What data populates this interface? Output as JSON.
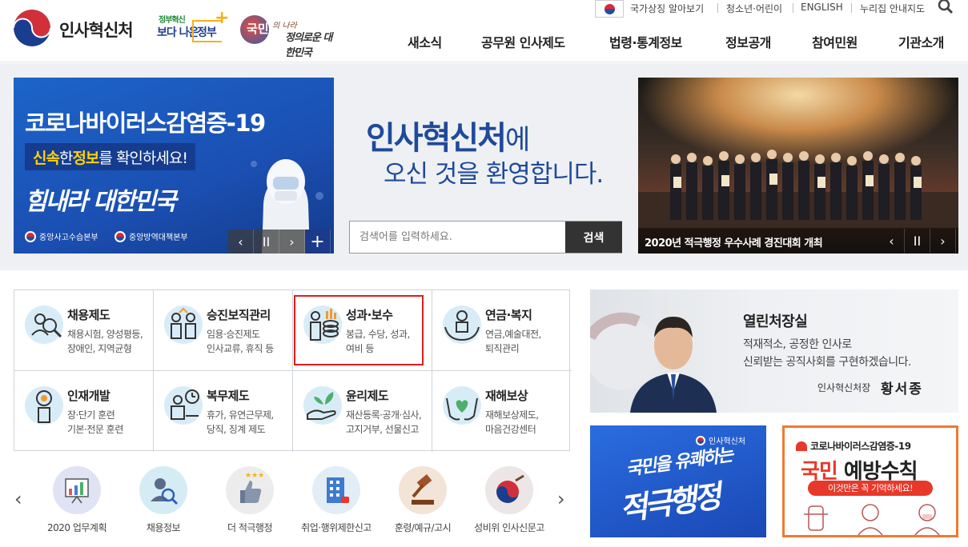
{
  "header": {
    "logo_text": "인사혁신처",
    "gov_innov_small": "정부혁신",
    "gov_innov_big": "보다 나은",
    "gov_innov_bracket": "정부",
    "people_logo_main": "국민",
    "people_logo_1": "의 나라",
    "people_logo_2": "정의로운 대한민국",
    "util_links": [
      "국가상징 알아보기",
      "청소년·어린이",
      "ENGLISH",
      "누리집 안내지도"
    ],
    "gnb": [
      "새소식",
      "공무원 인사제도",
      "법령·통계정보",
      "정보공개",
      "참여민원",
      "기관소개"
    ]
  },
  "hero": {
    "covid": {
      "title": "코로나바이러스감염증-19",
      "sub_y1": "신속",
      "sub_mid1": "한 ",
      "sub_y2": "정보",
      "sub_rest": "를 확인하세요!",
      "calligraphy": "힘내라 대한민국",
      "org1": "중앙사고수습본부",
      "org2": "중앙방역대책본부"
    },
    "controls": {
      "prev": "‹",
      "pause": "II",
      "next": "›",
      "more": "+"
    },
    "welcome_main": "인사혁신처",
    "welcome_suffix": "에",
    "welcome_line2": "오신 것을 환영합니다.",
    "search": {
      "placeholder": "검색어를 입력하세요.",
      "value": "",
      "button": "검색"
    },
    "photo_caption": "2020년 적극행정 우수사례 경진대회 개최"
  },
  "menu": [
    {
      "title": "채용제도",
      "desc1": "채용시험, 양성평등,",
      "desc2": "장애인, 지역균형",
      "icon": "recruit-icon"
    },
    {
      "title": "승진보직관리",
      "desc1": "임용·승진제도",
      "desc2": "인사교류, 휴직 등",
      "icon": "promotion-icon"
    },
    {
      "title": "성과·보수",
      "desc1": "봉급, 수당, 성과,",
      "desc2": "여비 등",
      "icon": "salary-icon"
    },
    {
      "title": "연금·복지",
      "desc1": "연금,예술대전,",
      "desc2": "퇴직관리",
      "icon": "pension-icon"
    },
    {
      "title": "인재개발",
      "desc1": "장·단기 훈련",
      "desc2": "기본·전문 훈련",
      "icon": "training-icon"
    },
    {
      "title": "복무제도",
      "desc1": "휴가, 유연근무제,",
      "desc2": "당직, 징계 제도",
      "icon": "service-icon"
    },
    {
      "title": "윤리제도",
      "desc1": "재산등록·공개·심사,",
      "desc2": "고지거부, 선물신고",
      "icon": "ethics-icon"
    },
    {
      "title": "재해보상",
      "desc1": "재해보상제도,",
      "desc2": "마음건강센터",
      "icon": "compensation-icon"
    }
  ],
  "quick_links": [
    {
      "label": "2020 업무계획",
      "icon": "plan-icon",
      "color": "#dfe3f4"
    },
    {
      "label": "채용정보",
      "icon": "job-search-icon",
      "color": "#d5ecf5"
    },
    {
      "label": "더 적극행정",
      "icon": "thumbs-up-icon",
      "color": "#ececec"
    },
    {
      "label": "취업·행위제한신고",
      "icon": "building-icon",
      "color": "#e2edf6"
    },
    {
      "label": "훈령/예규/고시",
      "icon": "gavel-icon",
      "color": "#f3e4d8"
    },
    {
      "label": "성비위 인사신문고",
      "icon": "drum-icon",
      "color": "#ece6e6"
    }
  ],
  "quick_nav": {
    "prev": "‹",
    "next": "›"
  },
  "minister": {
    "title": "열린처장실",
    "line1": "적재적소, 공정한 인사로",
    "line2": "신뢰받는 공직사회를 구현하겠습니다.",
    "sign_title": "인사혁신처장",
    "sign_name": "황서종"
  },
  "active_banner": {
    "logo": "인사혁신처",
    "line1": "국민을 유쾌하는",
    "line2": "적극행정"
  },
  "rules_banner": {
    "top": "코로나바이러스감염증-19",
    "main_a": "국민",
    "main_b": " 예방수칙",
    "pill": "이것만은 꼭 기억하세요!"
  },
  "colors": {
    "brand_blue": "#1f4a9a",
    "highlight_red": "#e01b1b",
    "orange_border": "#f07a2f"
  }
}
